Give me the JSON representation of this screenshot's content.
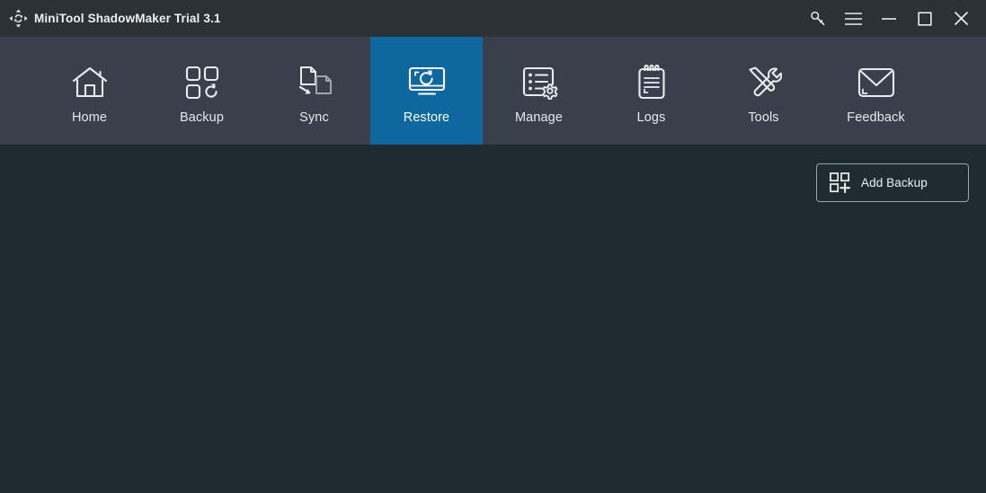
{
  "window": {
    "title": "MiniTool ShadowMaker Trial 3.1",
    "logo_icon": "sync-move-logo-icon",
    "titlebar_bg": "#2b3135",
    "controls": [
      {
        "name": "key-icon",
        "label": "Register",
        "tooltip": "Register"
      },
      {
        "name": "hamburger-icon",
        "label": "Menu",
        "tooltip": "Menu"
      },
      {
        "name": "minimize-icon",
        "label": "Minimize",
        "tooltip": "Minimize"
      },
      {
        "name": "maximize-icon",
        "label": "Maximize",
        "tooltip": "Maximize"
      },
      {
        "name": "close-icon",
        "label": "Close",
        "tooltip": "Close"
      }
    ]
  },
  "nav": {
    "bg": "#3a404b",
    "active_bg": "#0f679f",
    "active_index": 3,
    "items": [
      {
        "label": "Home",
        "icon": "house-icon"
      },
      {
        "label": "Backup",
        "icon": "grid-refresh-icon"
      },
      {
        "label": "Sync",
        "icon": "documents-arrow-icon"
      },
      {
        "label": "Restore",
        "icon": "monitor-refresh-icon"
      },
      {
        "label": "Manage",
        "icon": "list-gear-icon"
      },
      {
        "label": "Logs",
        "icon": "clipboard-icon"
      },
      {
        "label": "Tools",
        "icon": "wrench-screwdriver-icon"
      },
      {
        "label": "Feedback",
        "icon": "envelope-icon"
      }
    ]
  },
  "content": {
    "bg": "#1e2b30",
    "add_backup": {
      "label": "Add Backup",
      "icon": "grid-plus-icon"
    }
  }
}
